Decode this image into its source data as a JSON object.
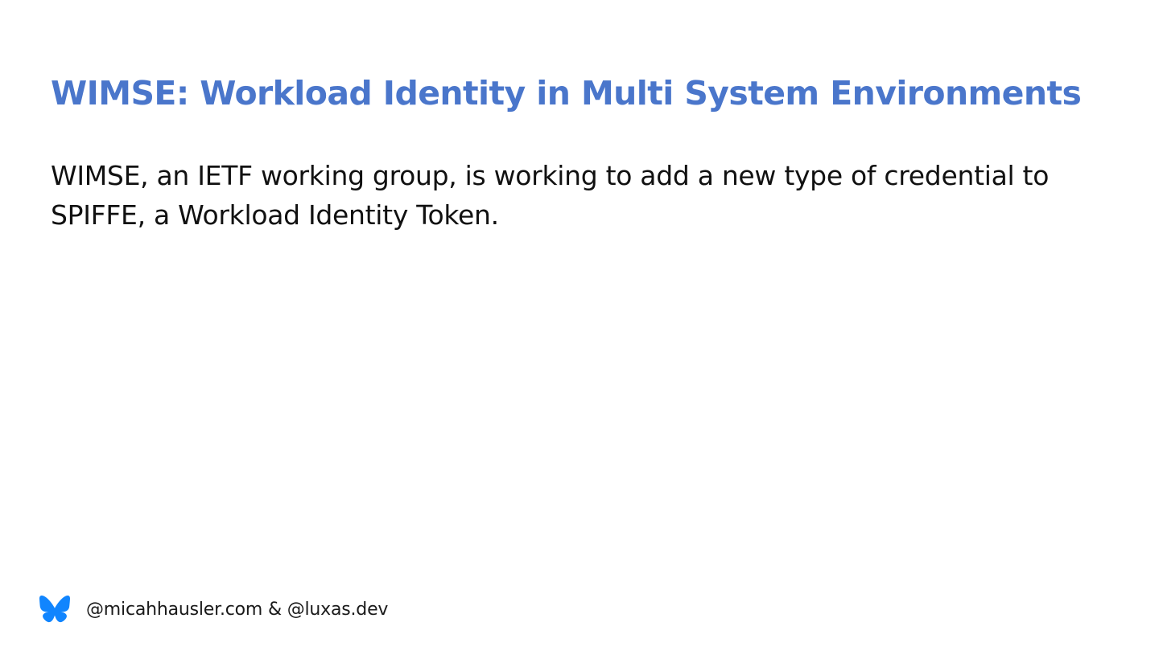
{
  "slide": {
    "title": "WIMSE: Workload Identity in Multi System Environments",
    "title_color": "#4a76cb",
    "body_line_1": "WIMSE, an IETF working group, is working to add a new type of credential to",
    "body_line_2_start": "SPIFFE, a ",
    "body_line_2_term": "Workload Identity Token",
    "body_line_2_end": "."
  },
  "footer": {
    "icon": "bluesky-butterfly-icon",
    "icon_color": "#1185fe",
    "handles": "@micahhausler.com & @luxas.dev"
  }
}
